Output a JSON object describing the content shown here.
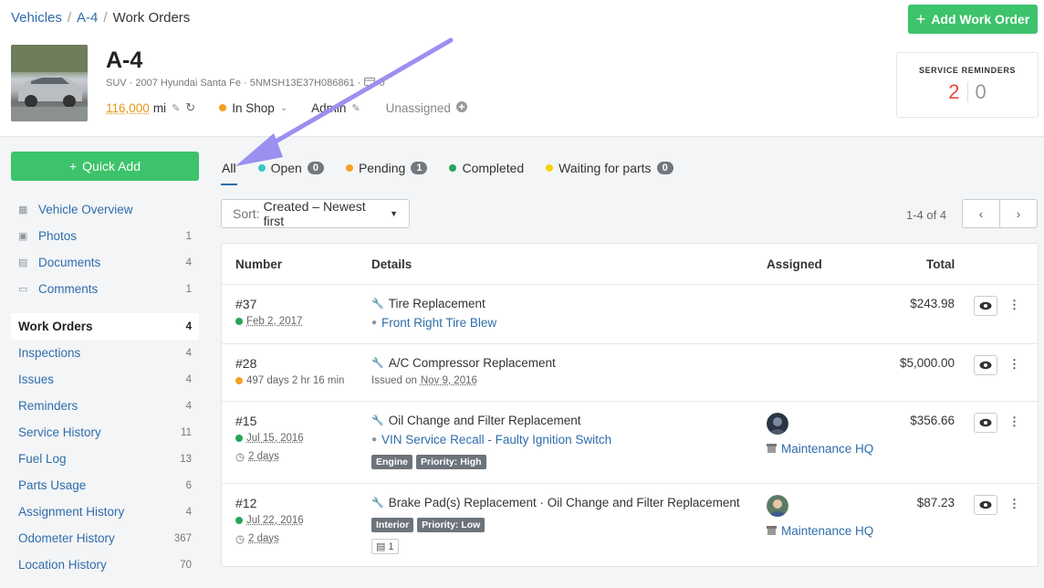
{
  "breadcrumb": {
    "vehicles": "Vehicles",
    "vehicle": "A-4",
    "current": "Work Orders",
    "sep": "/"
  },
  "header": {
    "add_button": "Add Work Order",
    "title": "A-4",
    "subinfo": "SUV · 2007 Hyundai Santa Fe · 5NMSH13E37H086861 ·",
    "subinfo_count": "0",
    "meter_value": "116,000",
    "meter_unit": "mi",
    "status": "In Shop",
    "group": "Admin",
    "operator": "Unassigned"
  },
  "reminders": {
    "label": "SERVICE REMINDERS",
    "overdue": "2",
    "due_soon": "0"
  },
  "sidebar": {
    "quick_add": "Quick Add",
    "top_items": [
      {
        "label": "Vehicle Overview",
        "count": ""
      },
      {
        "label": "Photos",
        "count": "1"
      },
      {
        "label": "Documents",
        "count": "4"
      },
      {
        "label": "Comments",
        "count": "1"
      }
    ],
    "items": [
      {
        "label": "Work Orders",
        "count": "4"
      },
      {
        "label": "Inspections",
        "count": "4"
      },
      {
        "label": "Issues",
        "count": "4"
      },
      {
        "label": "Reminders",
        "count": "4"
      },
      {
        "label": "Service History",
        "count": "11"
      },
      {
        "label": "Fuel Log",
        "count": "13"
      },
      {
        "label": "Parts Usage",
        "count": "6"
      },
      {
        "label": "Assignment History",
        "count": "4"
      },
      {
        "label": "Odometer History",
        "count": "367"
      },
      {
        "label": "Location History",
        "count": "70"
      }
    ]
  },
  "tabs": [
    {
      "label": "All"
    },
    {
      "label": "Open",
      "count": "0",
      "color": "#3bc7c9"
    },
    {
      "label": "Pending",
      "count": "1",
      "color": "#f5a021"
    },
    {
      "label": "Completed",
      "color": "#27a55a"
    },
    {
      "label": "Waiting for parts",
      "count": "0",
      "color": "#f2d600"
    }
  ],
  "sort": {
    "key": "Sort:",
    "value": "Created – Newest first"
  },
  "pagination": {
    "text": "1-4 of 4"
  },
  "table": {
    "headers": {
      "number": "Number",
      "details": "Details",
      "assigned": "Assigned",
      "total": "Total"
    },
    "rows": [
      {
        "number": "#37",
        "date": "Feb 2, 2017",
        "task": "Tire Replacement",
        "issue": "Front Right Tire Blew",
        "total": "$243.98"
      },
      {
        "number": "#28",
        "elapsed": "497 days 2 hr 16 min",
        "task": "A/C Compressor Replacement",
        "issued_label": "Issued on",
        "issued_date": "Nov 9, 2016",
        "total": "$5,000.00"
      },
      {
        "number": "#15",
        "date": "Jul 15, 2016",
        "duration": "2 days",
        "task": "Oil Change and Filter Replacement",
        "issue": "VIN Service Recall - Faulty Ignition Switch",
        "tags": [
          "Engine",
          "Priority: High"
        ],
        "location": "Maintenance HQ",
        "total": "$356.66"
      },
      {
        "number": "#12",
        "date": "Jul 22, 2016",
        "duration": "2 days",
        "task": "Brake Pad(s) Replacement · Oil Change and Filter Replacement",
        "tags": [
          "Interior",
          "Priority: Low"
        ],
        "attachments": "1",
        "location": "Maintenance HQ",
        "total": "$87.23"
      }
    ]
  },
  "colors": {
    "green": "#3cc36b",
    "link": "#2f6dab",
    "arrow": "#9b8ff0"
  }
}
